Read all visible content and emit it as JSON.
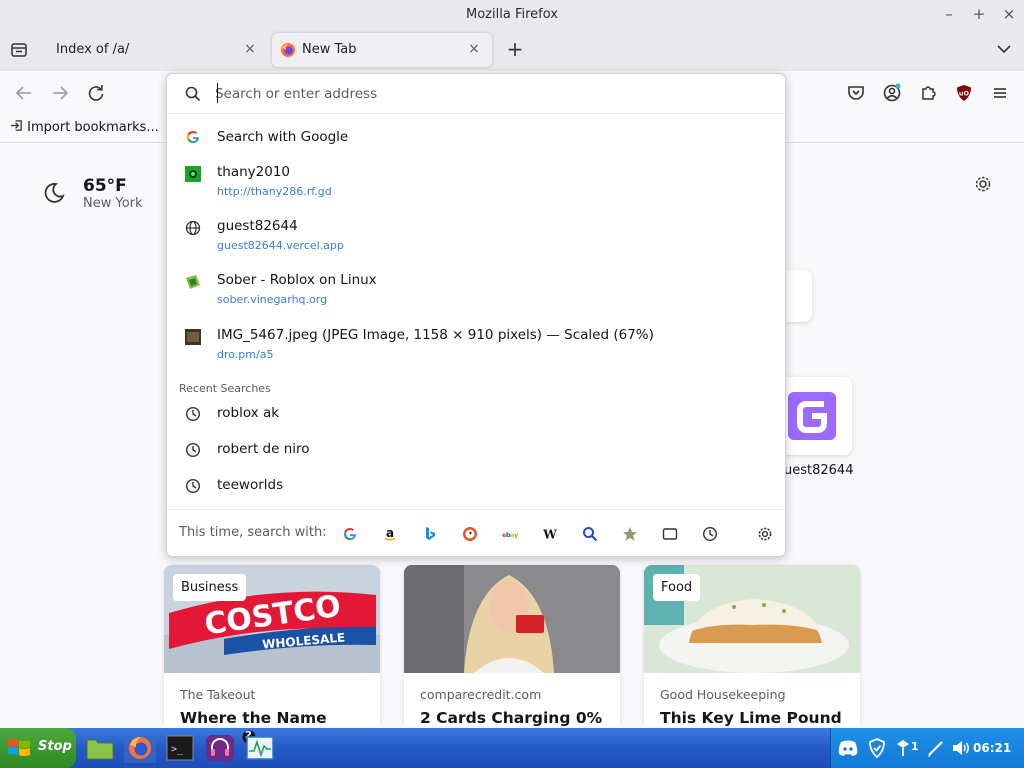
{
  "window": {
    "title": "Mozilla Firefox"
  },
  "tabs": [
    {
      "label": "Index of /a/"
    },
    {
      "label": "New Tab"
    }
  ],
  "addressbar": {
    "placeholder": "Search or enter address"
  },
  "bookmarks": {
    "import_label": "Import bookmarks..."
  },
  "weather": {
    "temp": "65°F",
    "city": "New York"
  },
  "shortcut": {
    "label": "uest82644"
  },
  "suggestions": [
    {
      "title": "Search with Google",
      "url": "",
      "icon": "google-icon"
    },
    {
      "title": "thany2010",
      "url": "http://thany286.rf.gd",
      "icon": "site-favicon"
    },
    {
      "title": "guest82644",
      "url": "guest82644.vercel.app",
      "icon": "globe-icon"
    },
    {
      "title": "Sober - Roblox on Linux",
      "url": "sober.vinegarhq.org",
      "icon": "sober-favicon"
    },
    {
      "title": "IMG_5467.jpeg (JPEG Image, 1158 × 910 pixels) — Scaled (67%)",
      "url": "dro.pm/a5",
      "icon": "image-thumb"
    }
  ],
  "recent": {
    "label": "Recent Searches",
    "items": [
      "roblox ak",
      "robert de niro",
      "teeworlds"
    ]
  },
  "oneoff": {
    "label": "This time, search with:"
  },
  "cards": [
    {
      "badge": "Business",
      "source": "The Takeout",
      "headline": "Where the Name"
    },
    {
      "badge": "",
      "source": "comparecredit.com",
      "headline": "2 Cards Charging 0%"
    },
    {
      "badge": "Food",
      "source": "Good Housekeeping",
      "headline": "This Key Lime Pound"
    }
  ],
  "taskbar": {
    "start_label": "Stop",
    "badge_count": "2",
    "tray_count": "1",
    "clock": "06:21"
  }
}
